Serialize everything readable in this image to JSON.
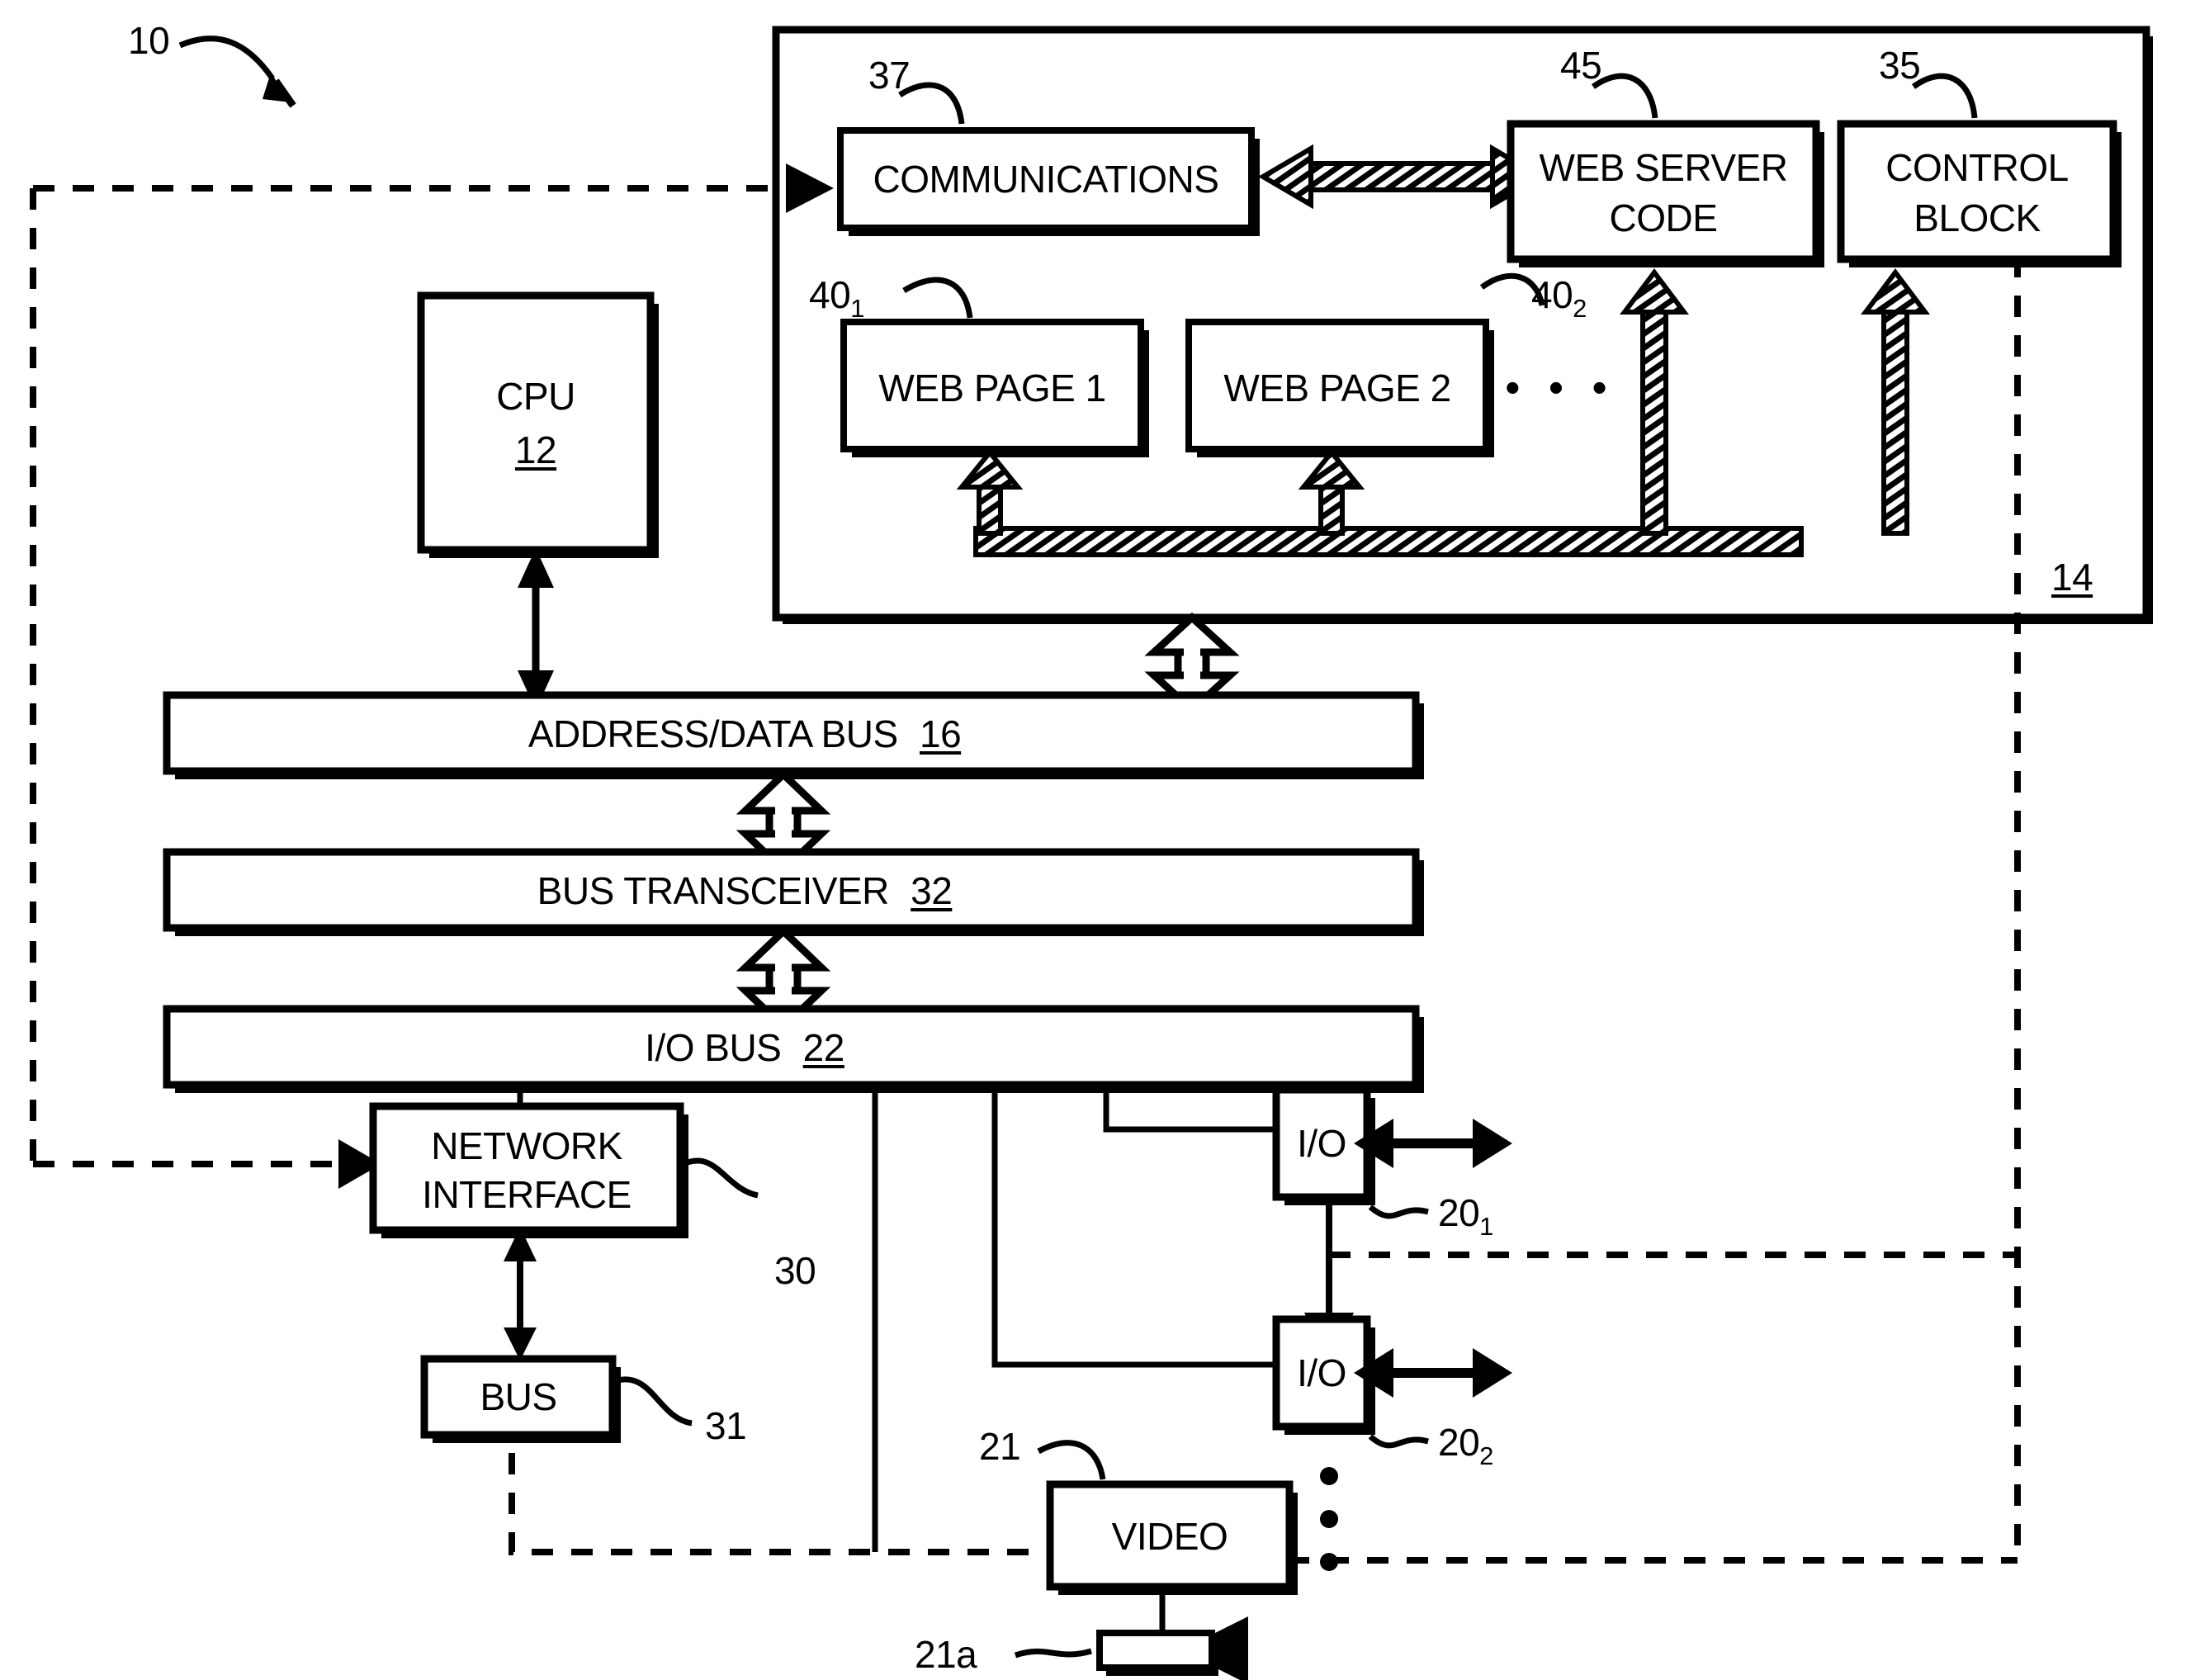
{
  "figure": {
    "system_ref": "10",
    "enclosure_ref": "14",
    "network_ref": "30",
    "bus_ref": "31"
  },
  "blocks": {
    "communications": {
      "label": "COMMUNICATIONS",
      "ref": "37"
    },
    "web_server_code": {
      "label_line1": "WEB SERVER",
      "label_line2": "CODE",
      "ref": "45"
    },
    "control_block": {
      "label_line1": "CONTROL",
      "label_line2": "BLOCK",
      "ref": "35"
    },
    "web_page_1": {
      "label": "WEB PAGE 1",
      "ref_base": "40",
      "ref_sub": "1"
    },
    "web_page_2": {
      "label": "WEB PAGE 2",
      "ref_base": "40",
      "ref_sub": "2"
    },
    "web_page_ellipsis": "• • •",
    "cpu": {
      "label": "CPU",
      "ref": "12"
    },
    "address_data_bus": {
      "label": "ADDRESS/DATA BUS",
      "ref": "16"
    },
    "bus_transceiver": {
      "label": "BUS TRANSCEIVER",
      "ref": "32"
    },
    "io_bus": {
      "label": "I/O BUS",
      "ref": "22"
    },
    "network_interface": {
      "label_line1": "NETWORK",
      "label_line2": "INTERFACE",
      "ref": "30"
    },
    "bus": {
      "label": "BUS",
      "ref": "31"
    },
    "io_1": {
      "label": "I/O",
      "ref_base": "20",
      "ref_sub": "1"
    },
    "io_2": {
      "label": "I/O",
      "ref_base": "20",
      "ref_sub": "2"
    },
    "io_ellipsis": "•",
    "video": {
      "label": "VIDEO",
      "ref": "21"
    },
    "camera": {
      "ref": "21a"
    }
  },
  "colors": {
    "ink": "#000000",
    "paper": "#ffffff"
  }
}
